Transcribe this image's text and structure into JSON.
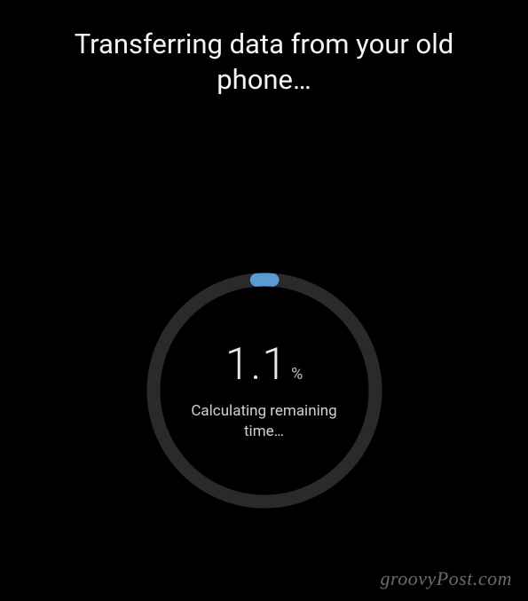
{
  "title": "Transferring data from your old phone…",
  "progress": {
    "value": "1.1",
    "symbol": "%",
    "percent_numeric": 1.1,
    "status": "Calculating remaining time…"
  },
  "watermark": "groovyPost.com",
  "colors": {
    "accent": "#5b9bd5",
    "ring_bg": "#2a2a2a",
    "background": "#000000"
  }
}
